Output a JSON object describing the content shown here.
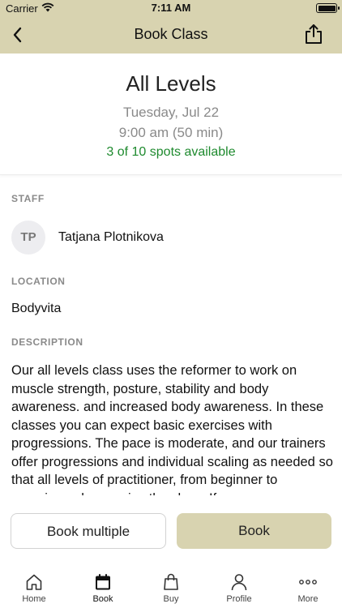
{
  "status_bar": {
    "carrier": "Carrier",
    "time": "7:11 AM"
  },
  "nav": {
    "title": "Book Class",
    "back_icon": "chevron-left-icon",
    "share_icon": "share-icon"
  },
  "class": {
    "name": "All Levels",
    "date": "Tuesday, Jul 22",
    "time": "9:00 am (50 min)",
    "spots": "3 of 10 spots available",
    "spots_color": "#1e8a2e"
  },
  "staff": {
    "label": "STAFF",
    "initials": "TP",
    "name": "Tatjana Plotnikova"
  },
  "location": {
    "label": "LOCATION",
    "value": "Bodyvita"
  },
  "description": {
    "label": "DESCRIPTION",
    "text": "Our all levels class uses the reformer to work on muscle strength, posture, stability and body awareness. and increased body awareness. In these classes you can expect basic exercises with progressions. The pace is moderate, and our trainers offer progressions and individual scaling as needed so that all levels of practitioner, from beginner to experienced can enjoy the class. If you"
  },
  "actions": {
    "book_multiple": "Book multiple",
    "book": "Book"
  },
  "tabs": [
    {
      "label": "Home",
      "icon": "home-icon",
      "active": false
    },
    {
      "label": "Book",
      "icon": "calendar-icon",
      "active": true
    },
    {
      "label": "Buy",
      "icon": "shopping-bag-icon",
      "active": false
    },
    {
      "label": "Profile",
      "icon": "person-icon",
      "active": false
    },
    {
      "label": "More",
      "icon": "more-dots-icon",
      "active": false
    }
  ],
  "colors": {
    "accent": "#d8d3b0",
    "label_gray": "#8a8a8a"
  }
}
